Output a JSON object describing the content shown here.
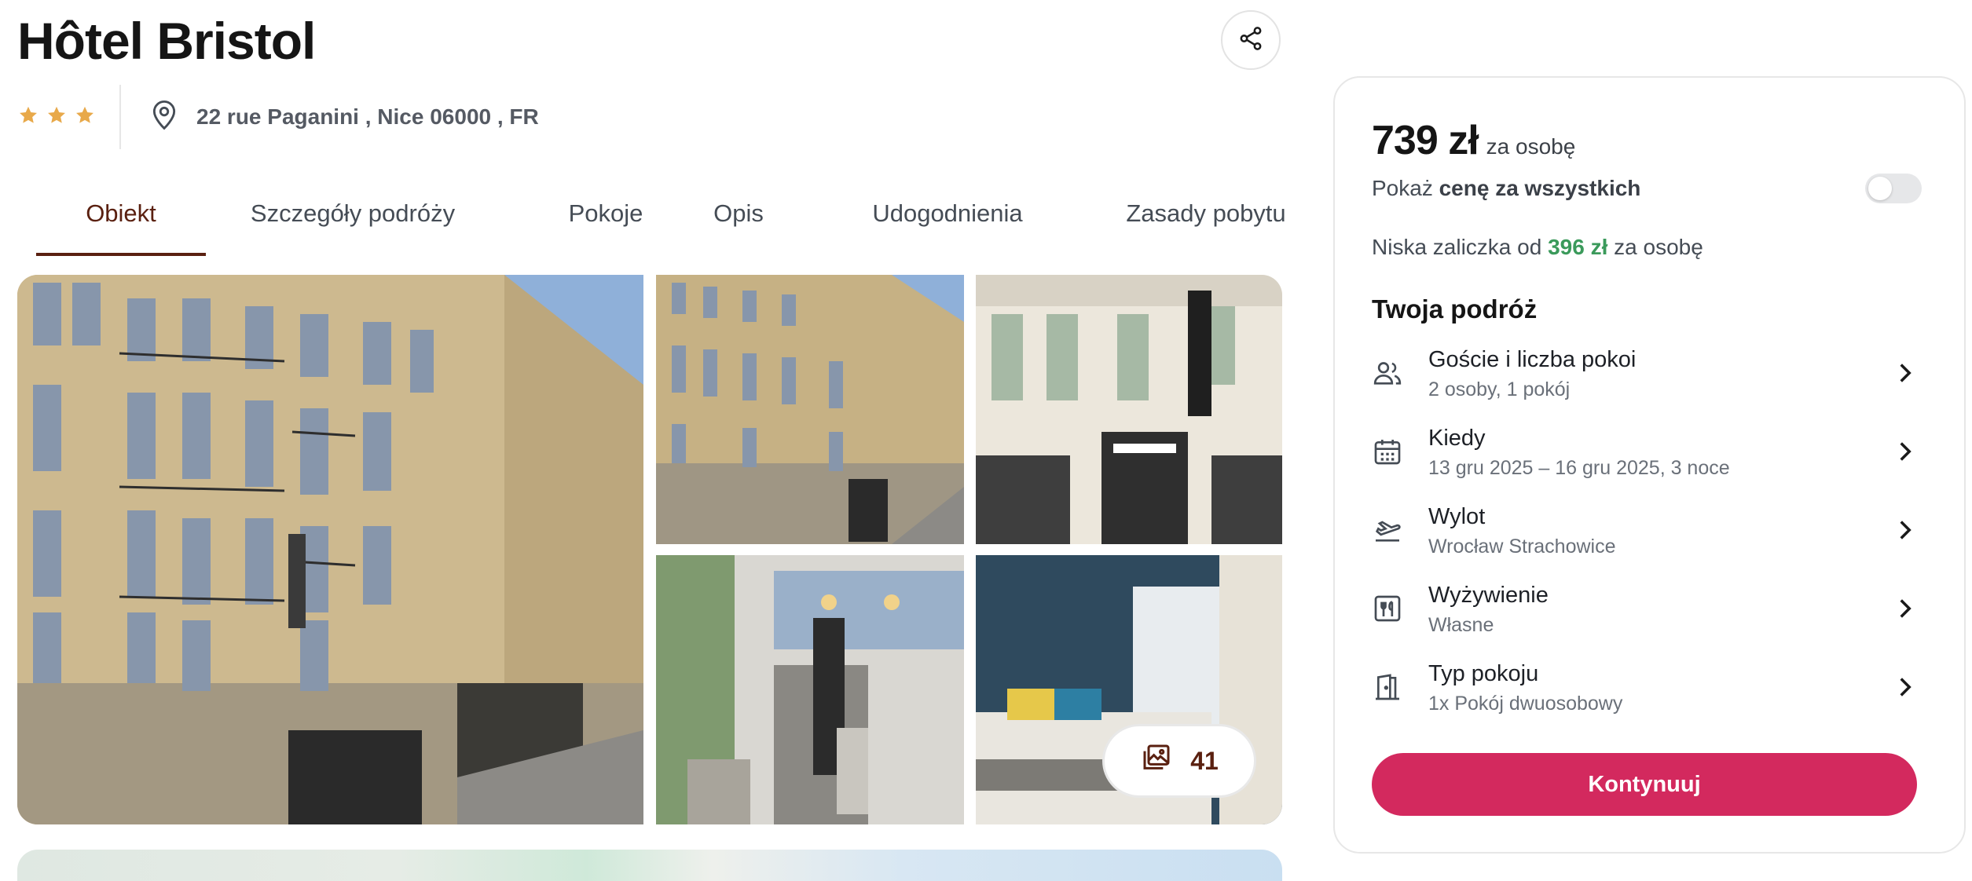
{
  "hotel": {
    "name": "Hôtel Bristol",
    "stars": 3,
    "address": "22 rue Paganini , Nice 06000 , FR"
  },
  "icons": {
    "share": "share-icon",
    "star": "star-icon",
    "location": "location-pin-icon",
    "gallery": "gallery-icon",
    "guests": "people-icon",
    "date": "calendar-icon",
    "flight": "plane-departure-icon",
    "meals": "meals-icon",
    "room": "door-icon",
    "chevron": "chevron-right-icon"
  },
  "tabs": [
    {
      "label": "Obiekt",
      "active": true
    },
    {
      "label": "Szczegóły podróży",
      "active": false
    },
    {
      "label": "Pokoje",
      "active": false
    },
    {
      "label": "Opis",
      "active": false
    },
    {
      "label": "Udogodnienia",
      "active": false
    },
    {
      "label": "Zasady pobytu",
      "active": false
    }
  ],
  "gallery": {
    "photo_count": "41"
  },
  "booking": {
    "price": "739 zł",
    "price_suffix": "za osobę",
    "toggle_prefix": "Pokaż",
    "toggle_bold": "cenę za wszystkich",
    "toggle_on": false,
    "deposit_prefix": "Niska zaliczka od",
    "deposit_amount": "396 zł",
    "deposit_suffix": "za osobę",
    "trip_title": "Twoja podróż",
    "trip_items": [
      {
        "label": "Goście i liczba pokoi",
        "value": "2 osoby, 1 pokój"
      },
      {
        "label": "Kiedy",
        "value": "13 gru 2025 – 16 gru 2025, 3 noce"
      },
      {
        "label": "Wylot",
        "value": "Wrocław Strachowice"
      },
      {
        "label": "Wyżywienie",
        "value": "Własne"
      },
      {
        "label": "Typ pokoju",
        "value": "1x Pokój dwuosobowy"
      }
    ],
    "continue_label": "Kontynuuj"
  },
  "colors": {
    "accent": "#5a2010",
    "primary_button": "#d3295e",
    "deposit_green": "#3b9a5b",
    "star": "#e8a94a"
  }
}
